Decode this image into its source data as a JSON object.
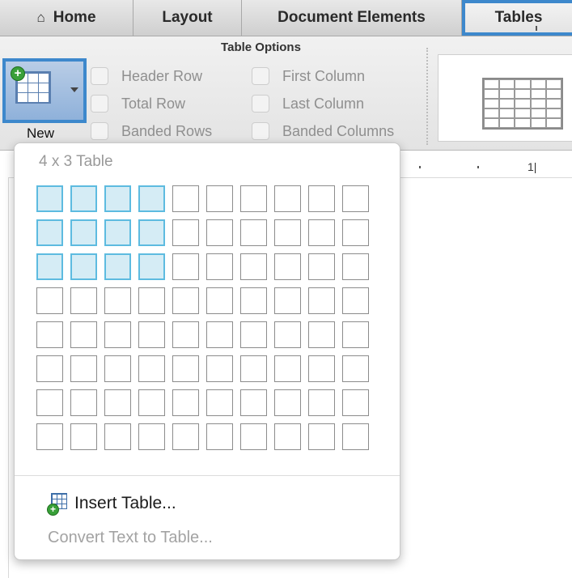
{
  "tabs": [
    {
      "id": "home",
      "label": "Home",
      "icon": "home-icon"
    },
    {
      "id": "layout",
      "label": "Layout"
    },
    {
      "id": "doc",
      "label": "Document Elements"
    },
    {
      "id": "tables",
      "label": "Tables",
      "active": true
    }
  ],
  "ribbon": {
    "group_title": "Table Options",
    "new_button": {
      "label": "New",
      "icon": "new-table-icon"
    },
    "options": [
      {
        "label": "Header Row",
        "checked": false
      },
      {
        "label": "Total Row",
        "checked": false
      },
      {
        "label": "Banded Rows",
        "checked": false
      },
      {
        "label": "First Column",
        "checked": false
      },
      {
        "label": "Last Column",
        "checked": false
      },
      {
        "label": "Banded Columns",
        "checked": false
      }
    ]
  },
  "ruler": {
    "number": "1|"
  },
  "dropdown": {
    "dimension_label": "4 x 3 Table",
    "grid": {
      "columns": 10,
      "rows": 8,
      "selected_columns": 4,
      "selected_rows": 3
    },
    "insert_table_label": "Insert Table...",
    "convert_label": "Convert Text to Table..."
  },
  "colors": {
    "accent": "#3d88cc",
    "selected_cell_fill": "#d5ecf5",
    "selected_cell_border": "#5dbbe0"
  }
}
